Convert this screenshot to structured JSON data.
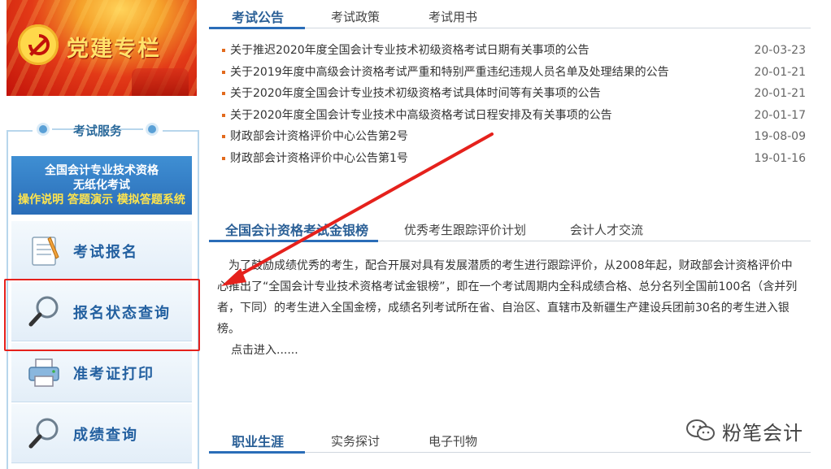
{
  "banner": {
    "title": "党建专栏"
  },
  "service": {
    "heading": "考试服务",
    "promo": {
      "line1": "全国会计专业技术资格",
      "line2": "无纸化考试",
      "line3": "操作说明 答题演示 模拟答题系统"
    },
    "buttons": [
      {
        "label": "考试报名",
        "icon": "notepad-icon"
      },
      {
        "label": "报名状态查询",
        "icon": "magnifier-icon"
      },
      {
        "label": "准考证打印",
        "icon": "printer-icon"
      },
      {
        "label": "成绩查询",
        "icon": "magnifier-icon"
      }
    ]
  },
  "announcements": {
    "tabs": [
      "考试公告",
      "考试政策",
      "考试用书"
    ],
    "items": [
      {
        "title": "关于推迟2020年度全国会计专业技术初级资格考试日期有关事项的公告",
        "date": "20-03-23"
      },
      {
        "title": "关于2019年度中高级会计资格考试严重和特别严重违纪违规人员名单及处理结果的公告",
        "date": "20-01-21"
      },
      {
        "title": "关于2020年度全国会计专业技术初级资格考试具体时间等有关事项的公告",
        "date": "20-01-21"
      },
      {
        "title": "关于2020年度全国会计专业技术中高级资格考试日程安排及有关事项的公告",
        "date": "20-01-17"
      },
      {
        "title": "财政部会计资格评价中心公告第2号",
        "date": "19-08-09"
      },
      {
        "title": "财政部会计资格评价中心公告第1号",
        "date": "19-01-16"
      }
    ]
  },
  "goldlist": {
    "tabs": [
      "全国会计资格考试金银榜",
      "优秀考生跟踪评价计划",
      "会计人才交流"
    ],
    "paragraph": "为了鼓励成绩优秀的考生，配合开展对具有发展潜质的考生进行跟踪评价，从2008年起，财政部会计资格评价中心推出了“全国会计专业技术资格考试金银榜”，即在一个考试周期内全科成绩合格、总分名列全国前100名（含并列者，下同）的考生进入全国金榜，成绩名列考试所在省、自治区、直辖市及新疆生产建设兵团前30名的考生进入银榜。",
    "more": "点击进入......"
  },
  "career": {
    "tabs": [
      "职业生涯",
      "实务探讨",
      "电子刊物"
    ]
  },
  "watermark": {
    "text": "粉笔会计",
    "icon": "wechat-icon"
  },
  "colors": {
    "accent": "#2a6db8",
    "highlight": "#e5211c",
    "bullet": "#e26a1d"
  }
}
